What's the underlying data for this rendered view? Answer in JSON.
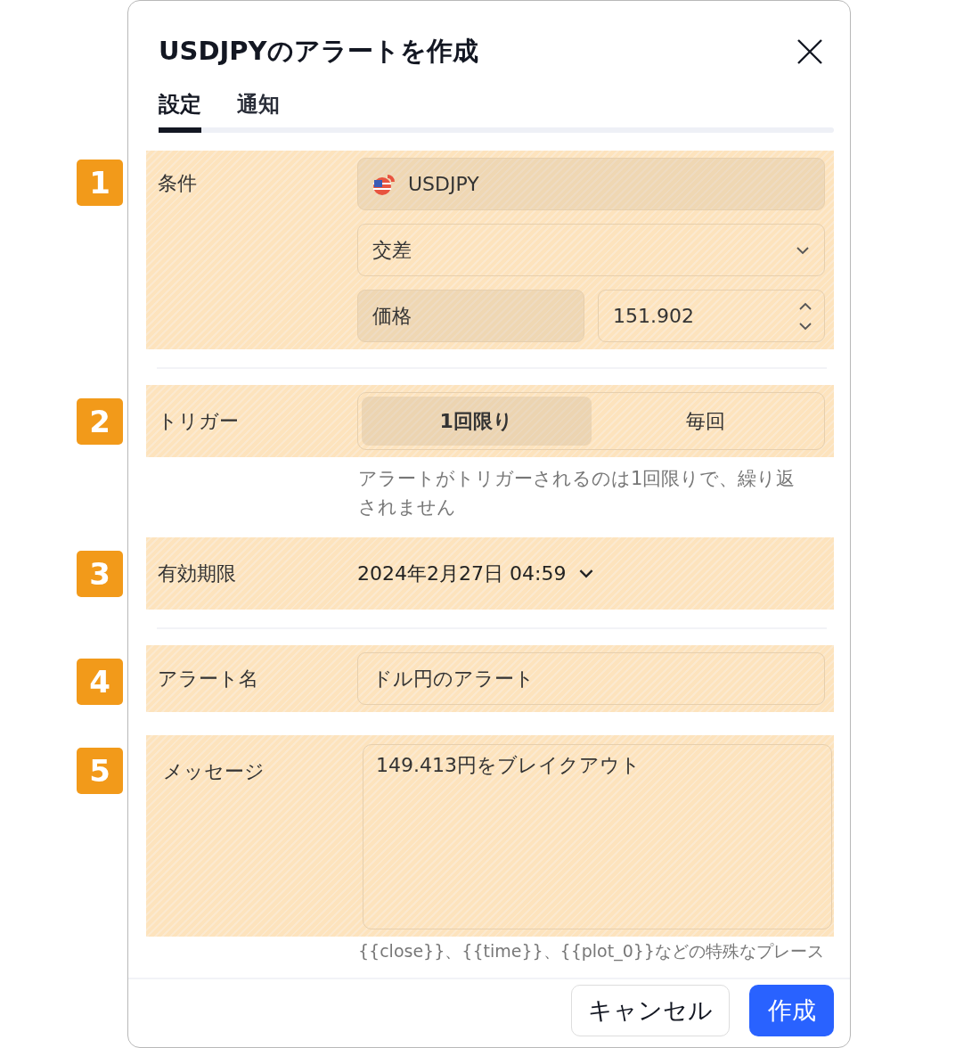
{
  "dialog": {
    "title": "USDJPYのアラートを作成"
  },
  "tabs": [
    {
      "label": "設定",
      "selected": true
    },
    {
      "label": "通知",
      "selected": false
    }
  ],
  "condition": {
    "badge": "1",
    "label": "条件",
    "symbol": "USDJPY",
    "operator": "交差",
    "source": "価格",
    "value": "151.902"
  },
  "trigger": {
    "badge": "2",
    "label": "トリガー",
    "options": [
      {
        "label": "1回限り",
        "selected": true
      },
      {
        "label": "毎回",
        "selected": false
      }
    ],
    "hint": "アラートがトリガーされるのは1回限りで、繰り返されません"
  },
  "expiry": {
    "badge": "3",
    "label": "有効期限",
    "value": "2024年2月27日 04:59"
  },
  "alert_name": {
    "badge": "4",
    "label": "アラート名",
    "value": "ドル円のアラート"
  },
  "message": {
    "badge": "5",
    "label": "メッセージ",
    "value": "149.413円をブレイクアウト",
    "hint": "{{close}}、{{time}}、{{plot_0}}などの特殊なプレース"
  },
  "buttons": [
    {
      "label": "キャンセル",
      "kind": "secondary"
    },
    {
      "label": "作成",
      "kind": "primary"
    }
  ]
}
